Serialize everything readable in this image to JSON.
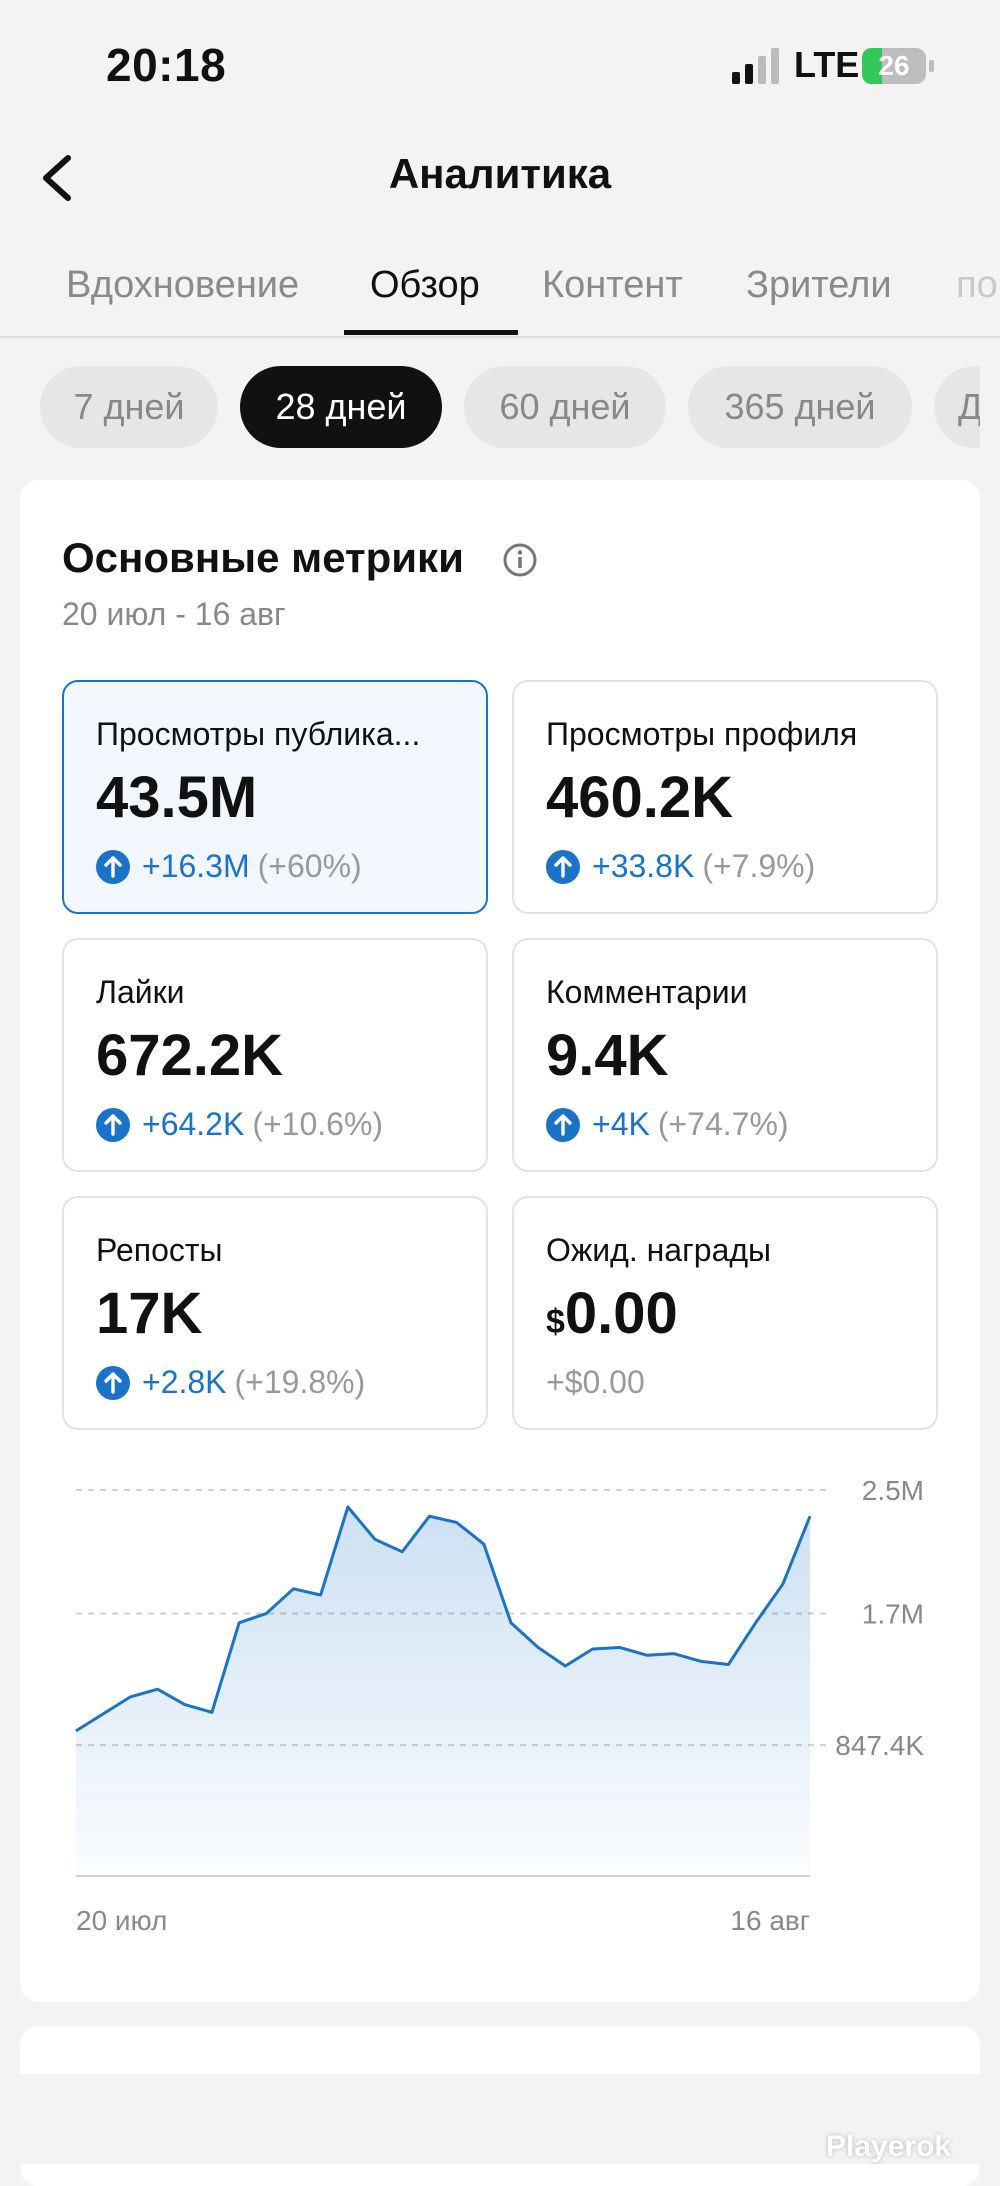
{
  "status": {
    "time": "20:18",
    "network": "LTE",
    "battery": "26"
  },
  "header": {
    "title": "Аналитика"
  },
  "tabs": [
    {
      "label": "Вдохновение",
      "active": false
    },
    {
      "label": "Обзор",
      "active": true
    },
    {
      "label": "Контент",
      "active": false
    },
    {
      "label": "Зрители",
      "active": false
    },
    {
      "label": "по",
      "active": false
    }
  ],
  "periods": [
    {
      "label": "7 дней",
      "active": false
    },
    {
      "label": "28 дней",
      "active": true
    },
    {
      "label": "60 дней",
      "active": false
    },
    {
      "label": "365 дней",
      "active": false
    },
    {
      "label": "Д",
      "active": false
    }
  ],
  "metrics_section": {
    "title": "Основные метрики",
    "date_range": "20 июл - 16 авг"
  },
  "metrics": [
    {
      "label": "Просмотры публика...",
      "currency": "",
      "value": "43.5M",
      "delta": "+16.3M",
      "pct": "(+60%)",
      "selected": true,
      "up": true
    },
    {
      "label": "Просмотры профиля",
      "currency": "",
      "value": "460.2K",
      "delta": "+33.8K",
      "pct": "(+7.9%)",
      "selected": false,
      "up": true
    },
    {
      "label": "Лайки",
      "currency": "",
      "value": "672.2K",
      "delta": "+64.2K",
      "pct": "(+10.6%)",
      "selected": false,
      "up": true
    },
    {
      "label": "Комментарии",
      "currency": "",
      "value": "9.4K",
      "delta": "+4K",
      "pct": "(+74.7%)",
      "selected": false,
      "up": true
    },
    {
      "label": "Репосты",
      "currency": "",
      "value": "17K",
      "delta": "+2.8K",
      "pct": "(+19.8%)",
      "selected": false,
      "up": true
    },
    {
      "label": "Ожид. награды",
      "currency": "$",
      "value": "0.00",
      "delta": "+$0.00",
      "pct": "",
      "selected": false,
      "up": false
    }
  ],
  "chart_data": {
    "type": "area",
    "x_labels": [
      "20 июл",
      "16 авг"
    ],
    "y_ticks": [
      "847.4K",
      "1.7M",
      "2.5M"
    ],
    "y_tick_values": [
      847400,
      1700000,
      2500000
    ],
    "ylim": [
      0,
      2500000
    ],
    "grid": true,
    "color": "#1a73c8",
    "values": [
      940000,
      1050000,
      1160000,
      1210000,
      1110000,
      1060000,
      1640000,
      1700000,
      1860000,
      1820000,
      2390000,
      2180000,
      2100000,
      2330000,
      2290000,
      2150000,
      1640000,
      1480000,
      1360000,
      1470000,
      1480000,
      1430000,
      1440000,
      1390000,
      1370000,
      1640000,
      1890000,
      2330000
    ]
  },
  "watermark": "Playerok",
  "colors": {
    "accent": "#1a73c8",
    "background": "#f3f3f3"
  }
}
